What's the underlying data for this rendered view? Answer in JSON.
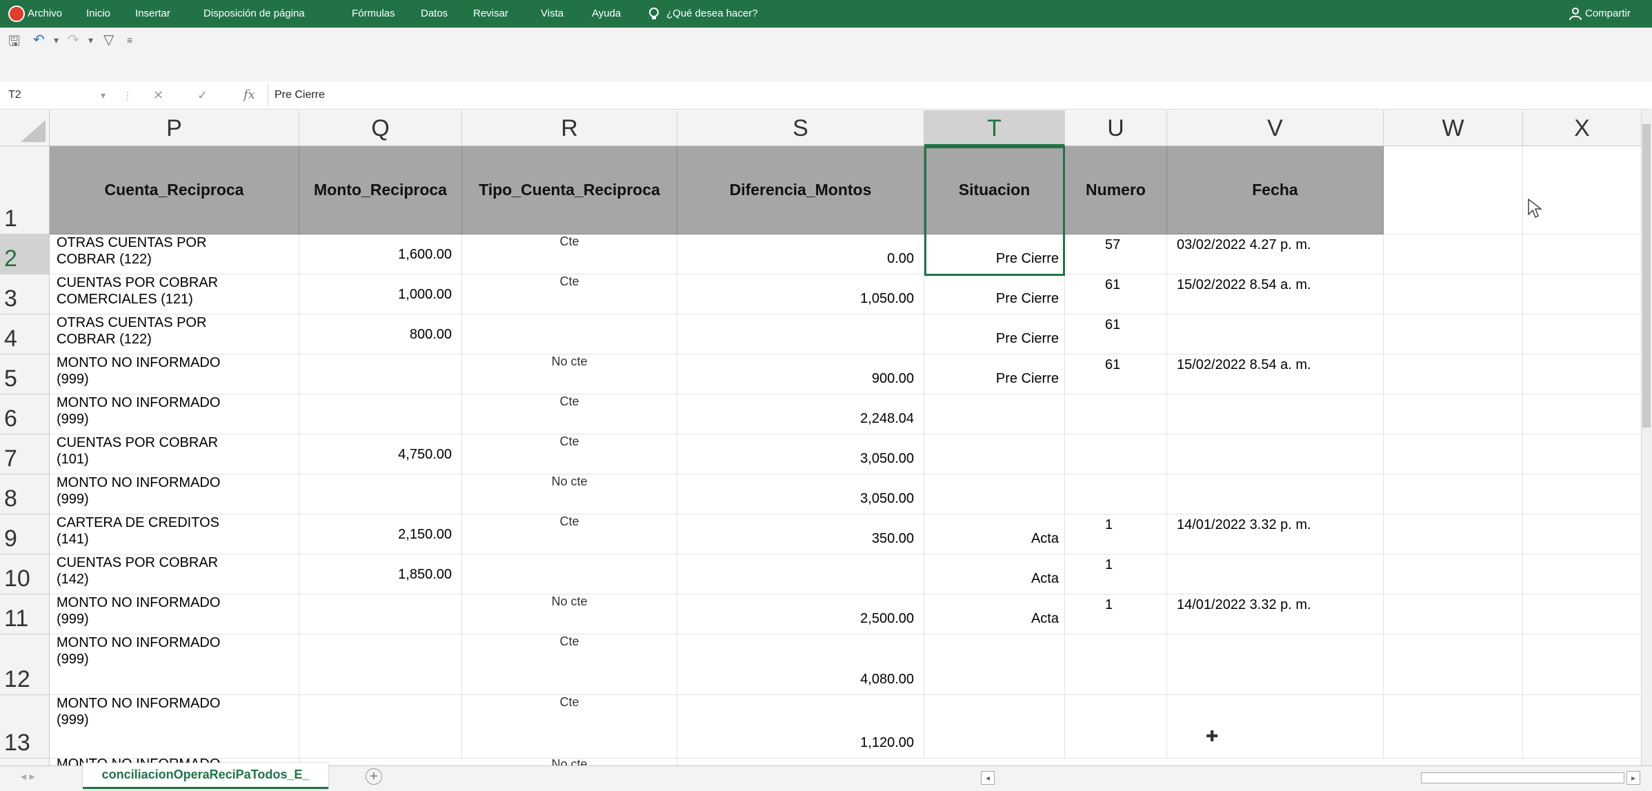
{
  "ribbon": {
    "tabs": [
      "Archivo",
      "Inicio",
      "Insertar",
      "Disposición de página",
      "Fórmulas",
      "Datos",
      "Revisar",
      "Vista",
      "Ayuda"
    ],
    "tell_me": "¿Qué desea hacer?",
    "share": "Compartir"
  },
  "formula_bar": {
    "name_box": "T2",
    "fx": "fx",
    "formula": "Pre Cierre"
  },
  "columns": [
    "P",
    "Q",
    "R",
    "S",
    "T",
    "U",
    "V",
    "W",
    "X"
  ],
  "active_column": "T",
  "rows": [
    "1",
    "2",
    "3",
    "4",
    "5",
    "6",
    "7",
    "8",
    "9",
    "10",
    "11",
    "12",
    "13"
  ],
  "active_row": "2",
  "header_row": [
    "Cuenta_Reciproca",
    "Monto_Reciproca",
    "Tipo_Cuenta_Reciproca",
    "Diferencia_Montos",
    "Situacion",
    "Numero",
    "Fecha"
  ],
  "data_rows": [
    {
      "cuenta": [
        "OTRAS CUENTAS POR",
        "COBRAR (122)"
      ],
      "monto": "1,600.00",
      "tipo": "Cte",
      "diferencia": "0.00",
      "situacion": "Pre Cierre",
      "numero": "57",
      "fecha": "03/02/2022 4.27 p. m."
    },
    {
      "cuenta": [
        "CUENTAS POR COBRAR",
        "COMERCIALES (121)"
      ],
      "monto": "1,000.00",
      "tipo": "Cte",
      "diferencia": "1,050.00",
      "situacion": "Pre Cierre",
      "numero": "61",
      "fecha": "15/02/2022 8.54 a. m."
    },
    {
      "cuenta": [
        "OTRAS CUENTAS POR",
        "COBRAR (122)"
      ],
      "monto": "800.00",
      "tipo": "",
      "diferencia": "",
      "situacion": "Pre Cierre",
      "numero": "61",
      "fecha": ""
    },
    {
      "cuenta": [
        "MONTO NO INFORMADO",
        "(999)"
      ],
      "monto": "",
      "tipo": "No cte",
      "diferencia": "900.00",
      "situacion": "Pre Cierre",
      "numero": "61",
      "fecha": "15/02/2022 8.54 a. m."
    },
    {
      "cuenta": [
        "MONTO NO INFORMADO",
        "(999)"
      ],
      "monto": "",
      "tipo": "Cte",
      "diferencia": "2,248.04",
      "situacion": "",
      "numero": "",
      "fecha": ""
    },
    {
      "cuenta": [
        "CUENTAS POR COBRAR",
        "(101)"
      ],
      "monto": "4,750.00",
      "tipo": "Cte",
      "diferencia": "3,050.00",
      "situacion": "",
      "numero": "",
      "fecha": ""
    },
    {
      "cuenta": [
        "MONTO NO INFORMADO",
        "(999)"
      ],
      "monto": "",
      "tipo": "No cte",
      "diferencia": "3,050.00",
      "situacion": "",
      "numero": "",
      "fecha": ""
    },
    {
      "cuenta": [
        "CARTERA DE CREDITOS",
        "(141)"
      ],
      "monto": "2,150.00",
      "tipo": "Cte",
      "diferencia": "350.00",
      "situacion": "Acta",
      "numero": "1",
      "fecha": "14/01/2022 3.32 p. m."
    },
    {
      "cuenta": [
        "CUENTAS POR COBRAR",
        "(142)"
      ],
      "monto": "1,850.00",
      "tipo": "",
      "diferencia": "",
      "situacion": "Acta",
      "numero": "1",
      "fecha": ""
    },
    {
      "cuenta": [
        "MONTO NO INFORMADO",
        "(999)"
      ],
      "monto": "",
      "tipo": "No cte",
      "diferencia": "2,500.00",
      "situacion": "Acta",
      "numero": "1",
      "fecha": "14/01/2022 3.32 p. m."
    },
    {
      "cuenta": [
        "MONTO NO INFORMADO",
        "(999)"
      ],
      "monto": "",
      "tipo": "Cte",
      "diferencia": "4,080.00",
      "situacion": "",
      "numero": "",
      "fecha": ""
    },
    {
      "cuenta": [
        "MONTO NO INFORMADO",
        "(999)"
      ],
      "monto": "",
      "tipo": "Cte",
      "diferencia": "1,120.00",
      "situacion": "",
      "numero": "",
      "fecha": ""
    }
  ],
  "partial_row": {
    "cuenta": "MONTO NO INFORMADO",
    "tipo": "No cte"
  },
  "sheet_tab": "conciliacionOperaReciPaTodos_E_",
  "colors": {
    "accent": "#217346",
    "header_fill": "#a6a6a6"
  }
}
